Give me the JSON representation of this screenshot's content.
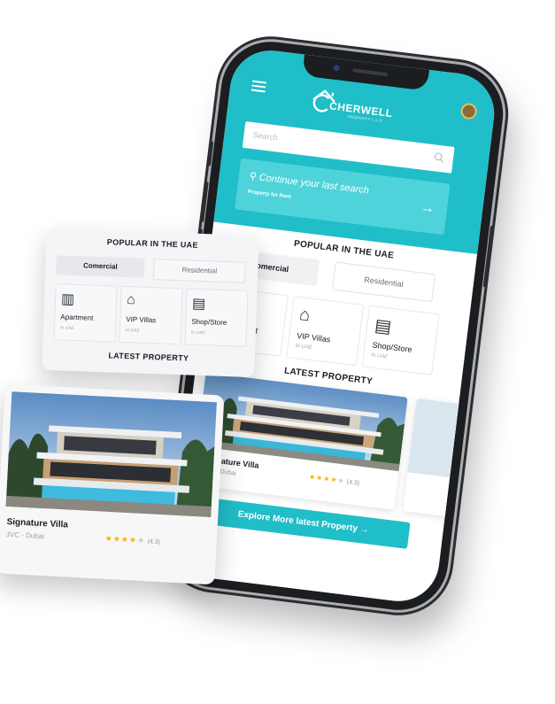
{
  "brand": {
    "name": "CHERWELL",
    "sub": "PROPERTY L.L.C"
  },
  "colors": {
    "accent": "#20bec8",
    "accent_light": "#4fd3da",
    "star": "#f4b400"
  },
  "search": {
    "placeholder": "Search"
  },
  "continue": {
    "title": "Continue your last search",
    "subtitle": "Property for Rent"
  },
  "popular": {
    "title": "POPULAR IN THE UAE",
    "tabs": [
      {
        "label": "Comercial"
      },
      {
        "label": "Residential"
      }
    ],
    "categories": [
      {
        "name": "Apartment",
        "location": "In UAE",
        "icon": "building-icon"
      },
      {
        "name": "VIP Villas",
        "location": "In UAE",
        "icon": "villa-icon"
      },
      {
        "name": "Shop/Store",
        "location": "In UAE",
        "icon": "store-icon"
      }
    ]
  },
  "latest": {
    "title": "LATEST PROPERTY",
    "listing": {
      "name": "Signature Villa",
      "location": "JVC - Dubai",
      "rating": 4,
      "rating_text": "(4.3)"
    },
    "explore_label": "Explore More latest Property"
  }
}
